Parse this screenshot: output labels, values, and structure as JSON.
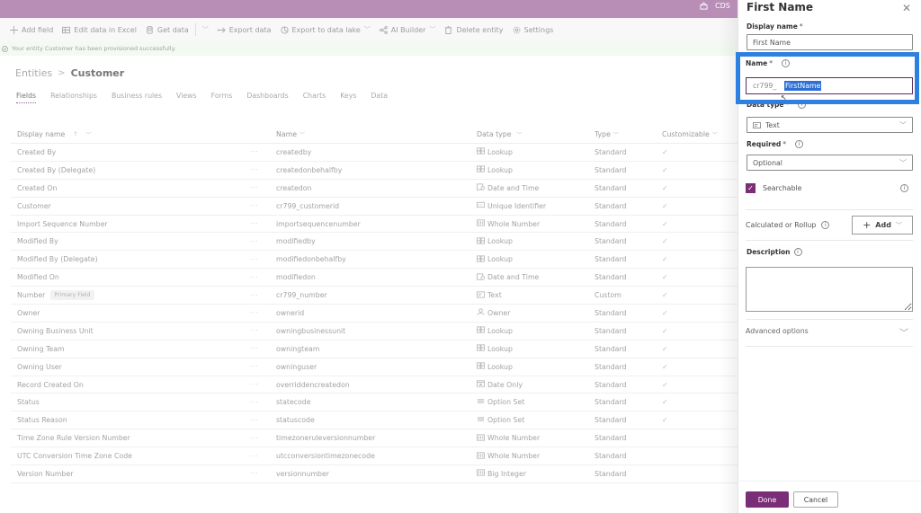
{
  "topbar": {
    "environment": "CDS"
  },
  "commands": [
    {
      "label": "Add field",
      "icon": "plus-icon"
    },
    {
      "label": "Edit data in Excel",
      "icon": "excel-icon"
    },
    {
      "label": "Get data",
      "icon": "database-icon"
    },
    {
      "label": "Export data",
      "icon": "export-arrow-icon"
    },
    {
      "label": "Export to data lake",
      "icon": "data-lake-icon"
    },
    {
      "label": "AI Builder",
      "icon": "ai-builder-icon"
    },
    {
      "label": "Delete entity",
      "icon": "delete-icon"
    },
    {
      "label": "Settings",
      "icon": "gear-icon"
    }
  ],
  "notice": "Your entity Customer has been provisioned successfully.",
  "breadcrumb": {
    "root": "Entities",
    "separator": ">",
    "current": "Customer"
  },
  "tabs": [
    "Fields",
    "Relationships",
    "Business rules",
    "Views",
    "Forms",
    "Dashboards",
    "Charts",
    "Keys",
    "Data"
  ],
  "active_tab": "Fields",
  "table": {
    "columns": [
      "Display name",
      "Name",
      "Data type",
      "Type",
      "Customizable"
    ],
    "sort_indicator": "↑",
    "more_glyph": "···",
    "check_glyph": "✓",
    "rows": [
      {
        "display": "Created By",
        "name": "createdby",
        "dtype": "Lookup",
        "icon": "lookup",
        "type": "Standard",
        "cust": true
      },
      {
        "display": "Created By (Delegate)",
        "name": "createdonbehalfby",
        "dtype": "Lookup",
        "icon": "lookup",
        "type": "Standard",
        "cust": true
      },
      {
        "display": "Created On",
        "name": "createdon",
        "dtype": "Date and Time",
        "icon": "datetime",
        "type": "Standard",
        "cust": true
      },
      {
        "display": "Customer",
        "name": "cr799_customerid",
        "dtype": "Unique Identifier",
        "icon": "uid",
        "type": "Standard",
        "cust": true
      },
      {
        "display": "Import Sequence Number",
        "name": "importsequencenumber",
        "dtype": "Whole Number",
        "icon": "number",
        "type": "Standard",
        "cust": true
      },
      {
        "display": "Modified By",
        "name": "modifiedby",
        "dtype": "Lookup",
        "icon": "lookup",
        "type": "Standard",
        "cust": true
      },
      {
        "display": "Modified By (Delegate)",
        "name": "modifiedonbehalfby",
        "dtype": "Lookup",
        "icon": "lookup",
        "type": "Standard",
        "cust": true
      },
      {
        "display": "Modified On",
        "name": "modifiedon",
        "dtype": "Date and Time",
        "icon": "datetime",
        "type": "Standard",
        "cust": true
      },
      {
        "display": "Number",
        "badge": "Primary Field",
        "name": "cr799_number",
        "dtype": "Text",
        "icon": "text",
        "type": "Custom",
        "cust": true
      },
      {
        "display": "Owner",
        "name": "ownerid",
        "dtype": "Owner",
        "icon": "owner",
        "type": "Standard",
        "cust": true
      },
      {
        "display": "Owning Business Unit",
        "name": "owningbusinessunit",
        "dtype": "Lookup",
        "icon": "lookup",
        "type": "Standard",
        "cust": true
      },
      {
        "display": "Owning Team",
        "name": "owningteam",
        "dtype": "Lookup",
        "icon": "lookup",
        "type": "Standard",
        "cust": true
      },
      {
        "display": "Owning User",
        "name": "owninguser",
        "dtype": "Lookup",
        "icon": "lookup",
        "type": "Standard",
        "cust": true
      },
      {
        "display": "Record Created On",
        "name": "overriddencreatedon",
        "dtype": "Date Only",
        "icon": "date",
        "type": "Standard",
        "cust": true
      },
      {
        "display": "Status",
        "name": "statecode",
        "dtype": "Option Set",
        "icon": "optionset",
        "type": "Standard",
        "cust": true
      },
      {
        "display": "Status Reason",
        "name": "statuscode",
        "dtype": "Option Set",
        "icon": "optionset",
        "type": "Standard",
        "cust": true
      },
      {
        "display": "Time Zone Rule Version Number",
        "name": "timezoneruleversionnumber",
        "dtype": "Whole Number",
        "icon": "number",
        "type": "Standard",
        "cust": false
      },
      {
        "display": "UTC Conversion Time Zone Code",
        "name": "utcconversiontimezonecode",
        "dtype": "Whole Number",
        "icon": "number",
        "type": "Standard",
        "cust": false
      },
      {
        "display": "Version Number",
        "name": "versionnumber",
        "dtype": "Big Integer",
        "icon": "number",
        "type": "Standard",
        "cust": false
      }
    ]
  },
  "panel": {
    "title": "First Name",
    "display_name_label": "Display name",
    "display_name_value": "First Name",
    "name_label": "Name",
    "name_prefix": "cr799_",
    "name_value": "FirstName",
    "data_type_label": "Data type",
    "data_type_value": "Text",
    "required_label": "Required",
    "required_value": "Optional",
    "searchable_label": "Searchable",
    "searchable_checked": true,
    "calc_label": "Calculated or Rollup",
    "add_label": "Add",
    "description_label": "Description",
    "description_value": "",
    "advanced_label": "Advanced options",
    "done_label": "Done",
    "cancel_label": "Cancel",
    "required_marker": "*"
  },
  "colors": {
    "brand": "#7a2e78",
    "topbar": "#b88eb6",
    "highlight": "#2d7fe0",
    "selection": "#2d6fd6"
  }
}
